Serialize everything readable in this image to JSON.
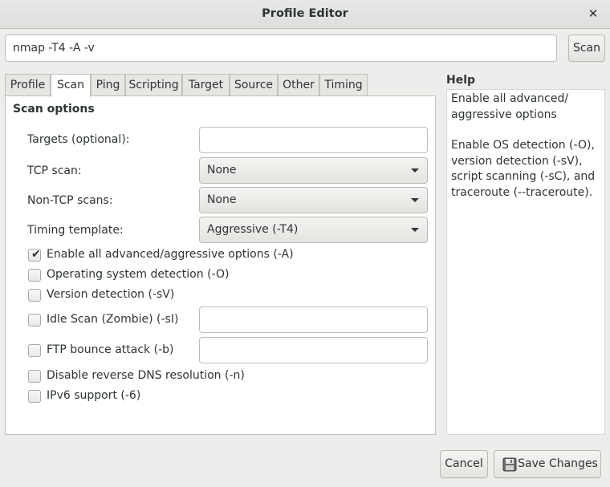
{
  "window": {
    "title": "Profile Editor",
    "close_glyph": "✕"
  },
  "command": {
    "value": "nmap -T4 -A -v",
    "scan_label": "Scan"
  },
  "tabs": [
    "Profile",
    "Scan",
    "Ping",
    "Scripting",
    "Target",
    "Source",
    "Other",
    "Timing"
  ],
  "active_tab": "Scan",
  "scan_options": {
    "section_title": "Scan options",
    "targets_label": "Targets (optional):",
    "targets_value": "",
    "tcp_scan_label": "TCP scan:",
    "tcp_scan_value": "None",
    "non_tcp_label": "Non-TCP scans:",
    "non_tcp_value": "None",
    "timing_label": "Timing template:",
    "timing_value": "Aggressive (-T4)",
    "checks": [
      {
        "label": "Enable all advanced/aggressive options (-A)",
        "checked": true
      },
      {
        "label": "Operating system detection (-O)",
        "checked": false
      },
      {
        "label": "Version detection (-sV)",
        "checked": false
      },
      {
        "label": "Idle Scan (Zombie) (-sI)",
        "checked": false
      },
      {
        "label": "FTP bounce attack (-b)",
        "checked": false
      },
      {
        "label": "Disable reverse DNS resolution (-n)",
        "checked": false
      },
      {
        "label": "IPv6 support (-6)",
        "checked": false
      }
    ],
    "idle_scan_value": "",
    "ftp_bounce_value": ""
  },
  "help": {
    "title": "Help",
    "paragraph1": "Enable all advanced/\naggressive options",
    "paragraph2": "Enable OS detection (-O),\nversion detection (-sV),\nscript scanning (-sC), and\ntraceroute (--traceroute)."
  },
  "footer": {
    "cancel_label": "Cancel",
    "save_label": "Save Changes"
  },
  "icons": {
    "close": "close-icon",
    "save": "save-icon",
    "dropdown": "chevron-down-icon",
    "check": "check-icon"
  }
}
